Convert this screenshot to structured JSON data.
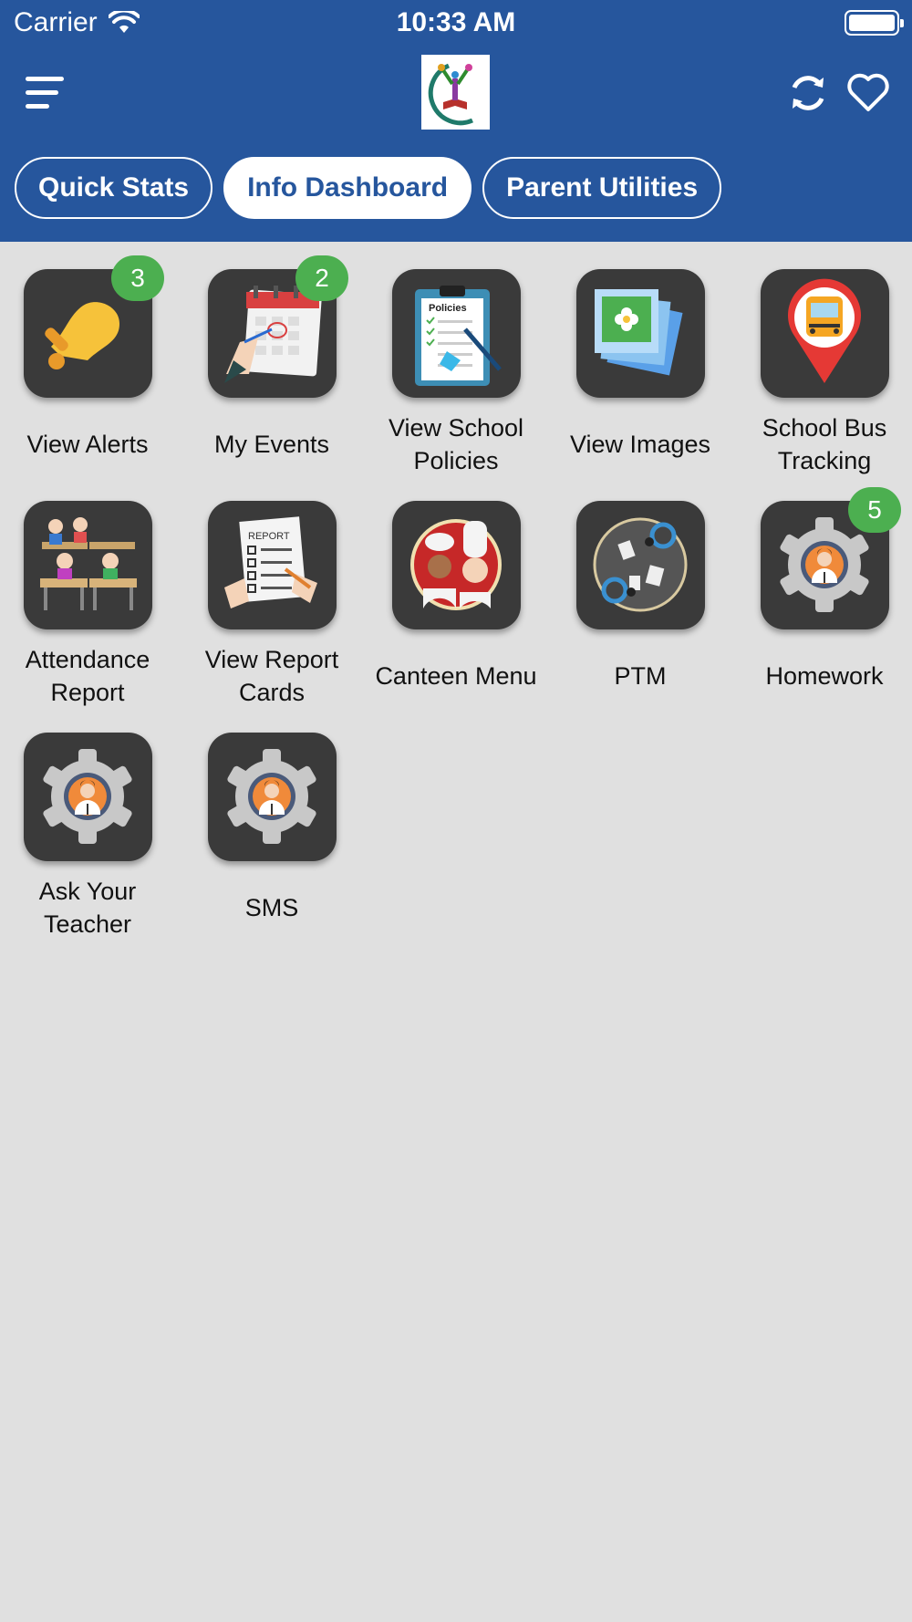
{
  "status_bar": {
    "carrier": "Carrier",
    "time": "10:33 AM"
  },
  "header": {
    "background_color": "#26569d",
    "menu_icon": "hamburger-menu-icon",
    "logo_icon": "school-logo-icon",
    "sync_icon": "sync-icon",
    "favorite_icon": "heart-icon"
  },
  "tabs": [
    {
      "label": "Quick Stats",
      "active": false
    },
    {
      "label": "Info Dashboard",
      "active": true
    },
    {
      "label": "Parent Utilities",
      "active": false
    }
  ],
  "tiles": [
    {
      "label": "View Alerts",
      "badge": "3",
      "icon": "bell-icon"
    },
    {
      "label": "My Events",
      "badge": "2",
      "icon": "calendar-icon"
    },
    {
      "label": "View School Policies",
      "badge": "",
      "icon": "policies-clipboard-icon"
    },
    {
      "label": "View Images",
      "badge": "",
      "icon": "photos-icon"
    },
    {
      "label": "School Bus Tracking",
      "badge": "",
      "icon": "bus-location-pin-icon"
    },
    {
      "label": "Attendance Report",
      "badge": "",
      "icon": "classroom-students-icon"
    },
    {
      "label": "View Report Cards",
      "badge": "",
      "icon": "report-card-icon"
    },
    {
      "label": "Canteen Menu",
      "badge": "",
      "icon": "chefs-icon"
    },
    {
      "label": "PTM",
      "badge": "",
      "icon": "meeting-table-icon"
    },
    {
      "label": "Homework",
      "badge": "5",
      "icon": "gear-person-icon"
    },
    {
      "label": "Ask Your Teacher",
      "badge": "",
      "icon": "gear-person-icon"
    },
    {
      "label": "SMS",
      "badge": "",
      "icon": "gear-person-icon"
    }
  ],
  "colors": {
    "badge": "#4caf50",
    "tile_background": "#3a3a3a",
    "page_background": "#e0e0e0"
  }
}
